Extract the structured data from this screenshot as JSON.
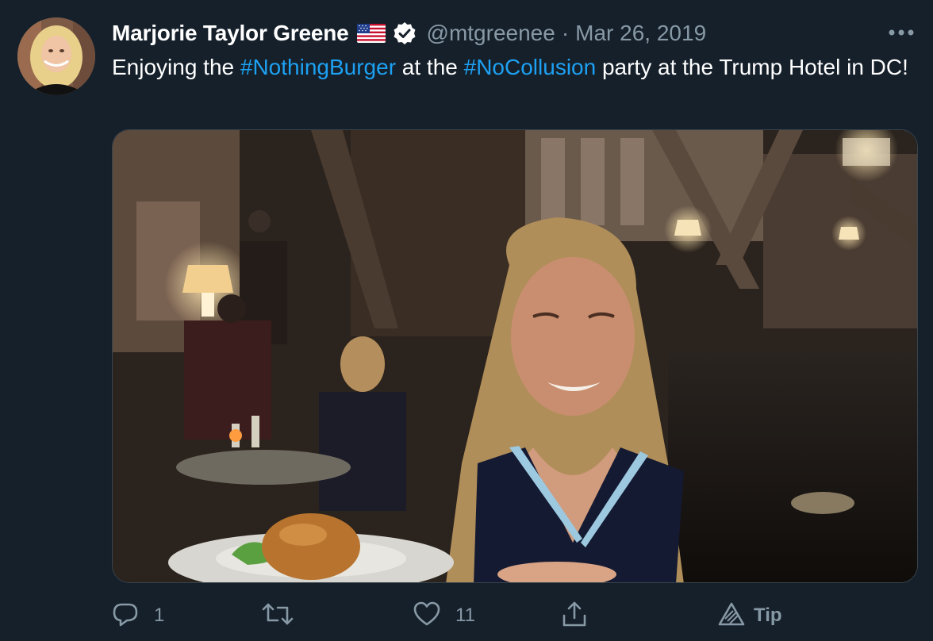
{
  "tweet": {
    "author_name": "Marjorie Taylor Greene",
    "flag_icon": "us-flag-icon",
    "verified_icon": "verified-badge-icon",
    "handle": "@mtgreenee",
    "separator": "·",
    "date": "Mar 26, 2019",
    "text_segments": [
      {
        "type": "text",
        "value": "Enjoying the "
      },
      {
        "type": "hashtag",
        "value": "#NothingBurger"
      },
      {
        "type": "text",
        "value": " at the "
      },
      {
        "type": "hashtag",
        "value": "#NoCollusion"
      },
      {
        "type": "text",
        "value": " party at the Trump Hotel in DC!"
      }
    ],
    "colors": {
      "background": "#15202b",
      "hashtag": "#1da1f2",
      "secondary_text": "#8899a6"
    }
  },
  "actions": {
    "reply": {
      "icon": "reply-icon",
      "count": "1"
    },
    "retweet": {
      "icon": "retweet-icon",
      "count": ""
    },
    "like": {
      "icon": "like-heart-icon",
      "count": "11"
    },
    "share": {
      "icon": "share-icon"
    },
    "tip": {
      "icon": "tip-icon",
      "label": "Tip"
    }
  },
  "more_icon": "more-options-icon"
}
